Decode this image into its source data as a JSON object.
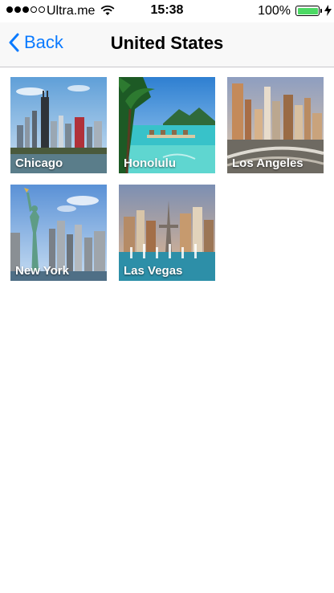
{
  "status_bar": {
    "carrier": "Ultra.me",
    "time": "15:38",
    "battery_percent": "100%",
    "battery_level": 1.0,
    "signal_bars_filled": 3,
    "signal_bars_total": 5
  },
  "nav": {
    "back_label": "Back",
    "title": "United States",
    "accent_color": "#0a7aff"
  },
  "cities": [
    {
      "name": "Chicago"
    },
    {
      "name": "Honolulu"
    },
    {
      "name": "Los Angeles"
    },
    {
      "name": "New York"
    },
    {
      "name": "Las Vegas"
    }
  ]
}
